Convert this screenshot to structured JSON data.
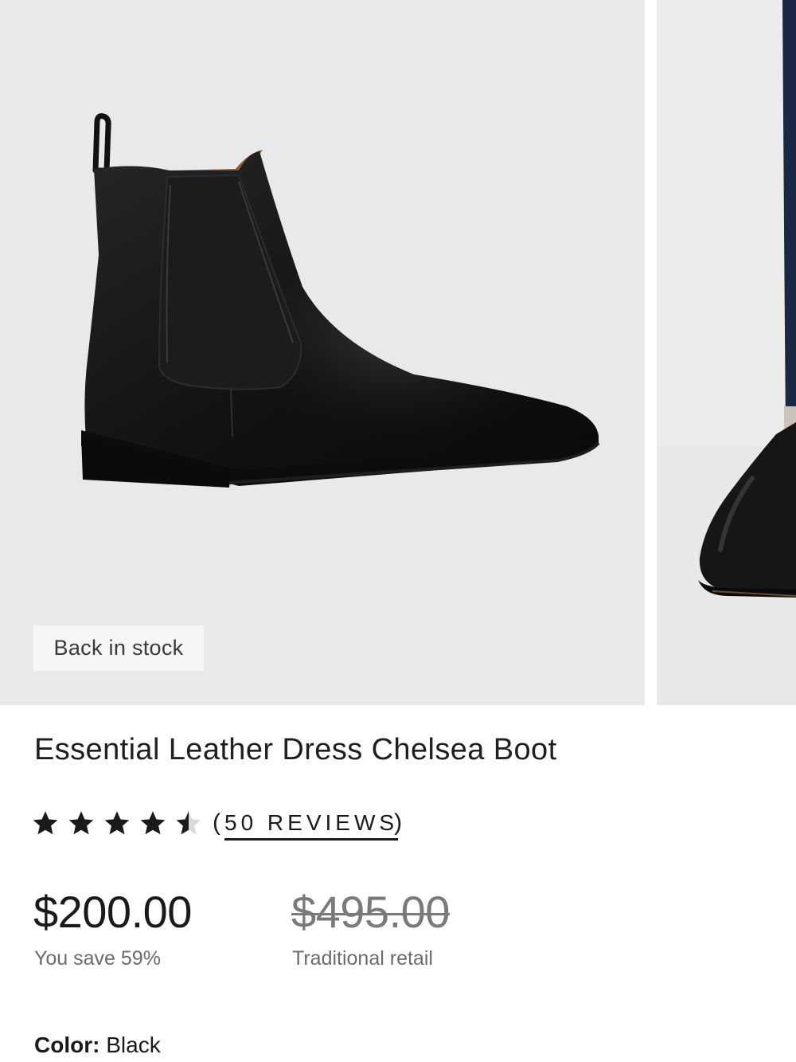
{
  "product": {
    "badge": "Back in stock",
    "title": "Essential Leather Dress Chelsea Boot",
    "rating": {
      "stars_out_of_5": 4.5,
      "reviews_label": "50 REVIEWS"
    },
    "price": "$200.00",
    "savings": "You save 59%",
    "retail_price": "$495.00",
    "retail_label": "Traditional retail",
    "color_label": "Color:",
    "color_value": "Black"
  },
  "images": {
    "main": "chelsea-boot-side-view",
    "next": "chelsea-boot-worn-with-jeans"
  },
  "colors": {
    "image_bg": "#e9e9ec",
    "text": "#1a1a1a",
    "muted": "#6b6b6b",
    "boot": "#141414"
  }
}
